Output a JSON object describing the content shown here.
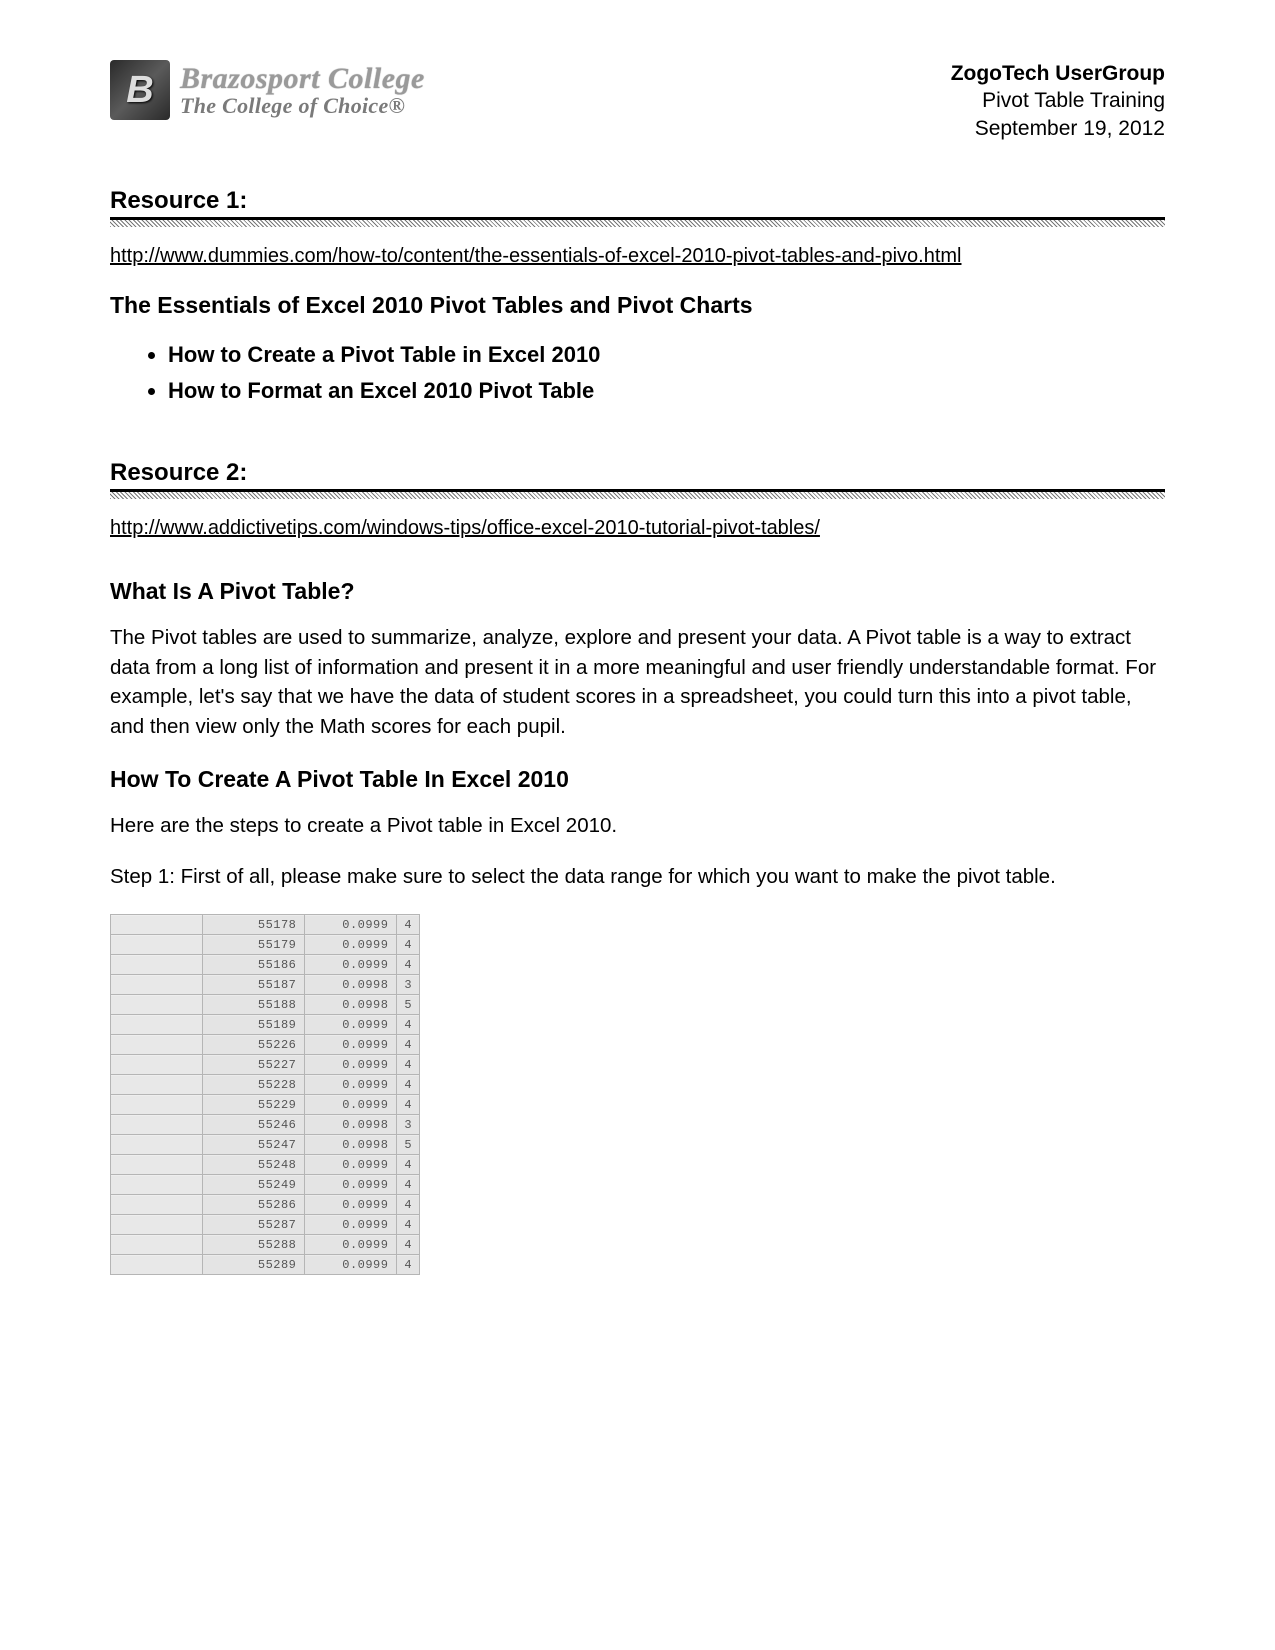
{
  "header": {
    "logo_title": "Brazosport College",
    "logo_sub": "The College of Choice®",
    "ug_title": "ZogoTech UserGroup",
    "ug_line2": "Pivot Table Training",
    "ug_date": "September 19, 2012"
  },
  "resource1": {
    "heading": "Resource 1:",
    "link": "http://www.dummies.com/how-to/content/the-essentials-of-excel-2010-pivot-tables-and-pivo.html",
    "title": "The Essentials of Excel 2010 Pivot Tables and Pivot Charts",
    "bullets": [
      "How to Create a Pivot Table in Excel 2010",
      "How to Format an Excel 2010 Pivot Table"
    ]
  },
  "resource2": {
    "heading": "Resource 2:",
    "link": "http://www.addictivetips.com/windows-tips/office-excel-2010-tutorial-pivot-tables/",
    "q_title": "What Is A Pivot Table?",
    "q_body": "The Pivot tables are used to summarize, analyze, explore and present your data. A Pivot table is a way to extract data from a long list of information and present it in a more meaningful and user friendly understandable format. For example, let's say that we have the data of student scores in a spreadsheet, you could turn this into a pivot table, and then view only the Math scores for each pupil.",
    "how_title": "How To Create A Pivot Table In Excel 2010",
    "how_intro": "Here are the steps to create a Pivot table in Excel 2010.",
    "step1": "Step 1: First of all, please make sure to select the data range for which you want to make the pivot table."
  },
  "table_rows": [
    {
      "c1": "",
      "c2": "55178",
      "c3": "0.0999",
      "c4": "4"
    },
    {
      "c1": "",
      "c2": "55179",
      "c3": "0.0999",
      "c4": "4"
    },
    {
      "c1": "",
      "c2": "55186",
      "c3": "0.0999",
      "c4": "4"
    },
    {
      "c1": "",
      "c2": "55187",
      "c3": "0.0998",
      "c4": "3"
    },
    {
      "c1": "",
      "c2": "55188",
      "c3": "0.0998",
      "c4": "5"
    },
    {
      "c1": "",
      "c2": "55189",
      "c3": "0.0999",
      "c4": "4"
    },
    {
      "c1": "",
      "c2": "55226",
      "c3": "0.0999",
      "c4": "4"
    },
    {
      "c1": "",
      "c2": "55227",
      "c3": "0.0999",
      "c4": "4"
    },
    {
      "c1": "",
      "c2": "55228",
      "c3": "0.0999",
      "c4": "4"
    },
    {
      "c1": "",
      "c2": "55229",
      "c3": "0.0999",
      "c4": "4"
    },
    {
      "c1": "",
      "c2": "55246",
      "c3": "0.0998",
      "c4": "3"
    },
    {
      "c1": "",
      "c2": "55247",
      "c3": "0.0998",
      "c4": "5"
    },
    {
      "c1": "",
      "c2": "55248",
      "c3": "0.0999",
      "c4": "4"
    },
    {
      "c1": "",
      "c2": "55249",
      "c3": "0.0999",
      "c4": "4"
    },
    {
      "c1": "",
      "c2": "55286",
      "c3": "0.0999",
      "c4": "4"
    },
    {
      "c1": "",
      "c2": "55287",
      "c3": "0.0999",
      "c4": "4"
    },
    {
      "c1": "",
      "c2": "55288",
      "c3": "0.0999",
      "c4": "4"
    },
    {
      "c1": "",
      "c2": "55289",
      "c3": "0.0999",
      "c4": "4"
    }
  ]
}
